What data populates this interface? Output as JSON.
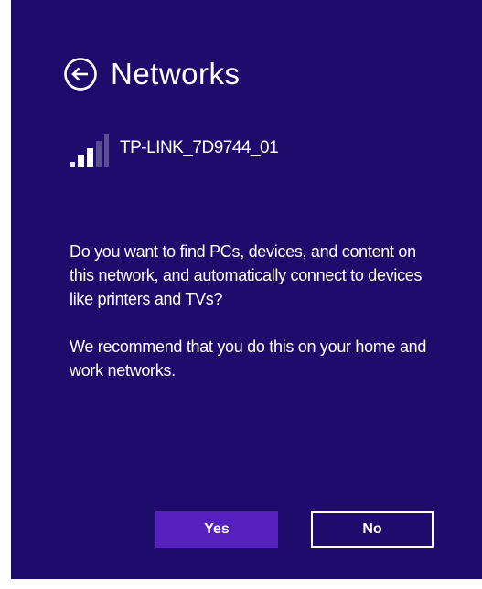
{
  "header": {
    "back_icon": "back-arrow-circle-icon",
    "title": "Networks"
  },
  "network": {
    "signal_icon": "wifi-signal-bars-icon",
    "signal_strength": "3 of 5 bars",
    "ssid": "TP-LINK_7D9744_01"
  },
  "message": {
    "question": "Do you want to find PCs, devices, and content on this network, and automatically connect to devices like printers and TVs?",
    "recommendation": "We recommend that you do this on your home and work networks."
  },
  "buttons": {
    "yes_label": "Yes",
    "no_label": "No"
  },
  "colors": {
    "panel_background": "#1d0c6b",
    "accent_button": "#5520bd",
    "text": "#ffffff"
  }
}
